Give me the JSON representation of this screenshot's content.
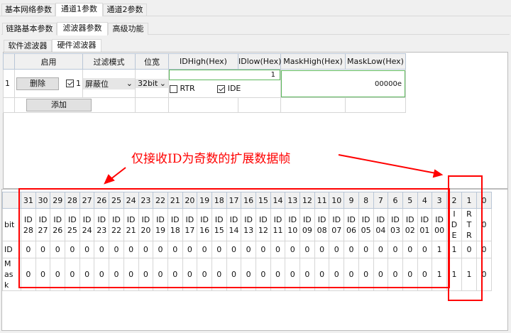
{
  "tabs_main": [
    "基本网络参数",
    "通道1参数",
    "通道2参数"
  ],
  "tabs_sub": [
    "链路基本参数",
    "滤波器参数",
    "高级功能"
  ],
  "tabs_filter": [
    "软件滤波器",
    "硬件滤波器"
  ],
  "grid": {
    "headers": [
      "启用",
      "过滤模式",
      "位宽",
      "IDHigh(Hex)",
      "IDlow(Hex)",
      "MaskHigh(Hex)",
      "MaskLow(Hex)"
    ],
    "row": {
      "index": "1",
      "delete_label": "删除",
      "enabled": true,
      "enabled_label": "1",
      "mode": "屏蔽位",
      "width": "32bit",
      "id_value": "1",
      "rtr_label": "RTR",
      "rtr": false,
      "ide_label": "IDE",
      "ide": true,
      "mask_value": "00000e"
    },
    "add_label": "添加"
  },
  "annotation": {
    "text": "仅接收ID为奇数的扩展数据帧",
    "color": "#ff0000"
  },
  "bits": {
    "row_labels": [
      "bit",
      "ID",
      "Mask"
    ],
    "columns": [
      "31",
      "30",
      "29",
      "28",
      "27",
      "26",
      "25",
      "24",
      "23",
      "22",
      "21",
      "20",
      "19",
      "18",
      "17",
      "16",
      "15",
      "14",
      "13",
      "12",
      "11",
      "10",
      "9",
      "8",
      "7",
      "6",
      "5",
      "4",
      "3",
      "2",
      "1",
      "0"
    ],
    "bit_names": [
      "ID\n28",
      "ID\n27",
      "ID\n26",
      "ID\n25",
      "ID\n24",
      "ID\n23",
      "ID\n22",
      "ID\n21",
      "ID\n20",
      "ID\n19",
      "ID\n18",
      "ID\n17",
      "ID\n16",
      "ID\n15",
      "ID\n14",
      "ID\n13",
      "ID\n12",
      "ID\n11",
      "ID\n10",
      "ID\n09",
      "ID\n08",
      "ID\n07",
      "ID\n06",
      "ID\n05",
      "ID\n04",
      "ID\n03",
      "ID\n02",
      "ID\n01",
      "ID\n00",
      "I\nD\nE",
      "R\nT\nR",
      "0"
    ],
    "id": [
      "0",
      "0",
      "0",
      "0",
      "0",
      "0",
      "0",
      "0",
      "0",
      "0",
      "0",
      "0",
      "0",
      "0",
      "0",
      "0",
      "0",
      "0",
      "0",
      "0",
      "0",
      "0",
      "0",
      "0",
      "0",
      "0",
      "0",
      "0",
      "1",
      "1",
      "0",
      "0"
    ],
    "mask": [
      "0",
      "0",
      "0",
      "0",
      "0",
      "0",
      "0",
      "0",
      "0",
      "0",
      "0",
      "0",
      "0",
      "0",
      "0",
      "0",
      "0",
      "0",
      "0",
      "0",
      "0",
      "0",
      "0",
      "0",
      "0",
      "0",
      "0",
      "0",
      "1",
      "1",
      "1",
      "0"
    ]
  }
}
